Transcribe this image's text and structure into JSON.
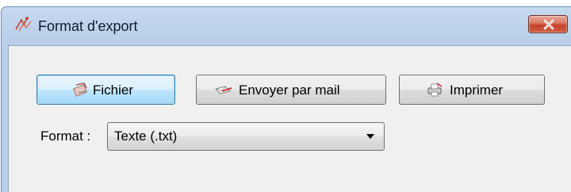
{
  "window": {
    "title": "Format d'export",
    "title_icon": "export-arrows-icon",
    "close_icon": "close-icon",
    "close_color": "#c4432a"
  },
  "buttons": {
    "file": {
      "label": "Fichier",
      "icon": "file-icon"
    },
    "mail": {
      "label": "Envoyer par mail",
      "icon": "mail-icon"
    },
    "print": {
      "label": "Imprimer",
      "icon": "printer-icon"
    }
  },
  "format": {
    "label": "Format :",
    "selected": "Texte (.txt)"
  }
}
